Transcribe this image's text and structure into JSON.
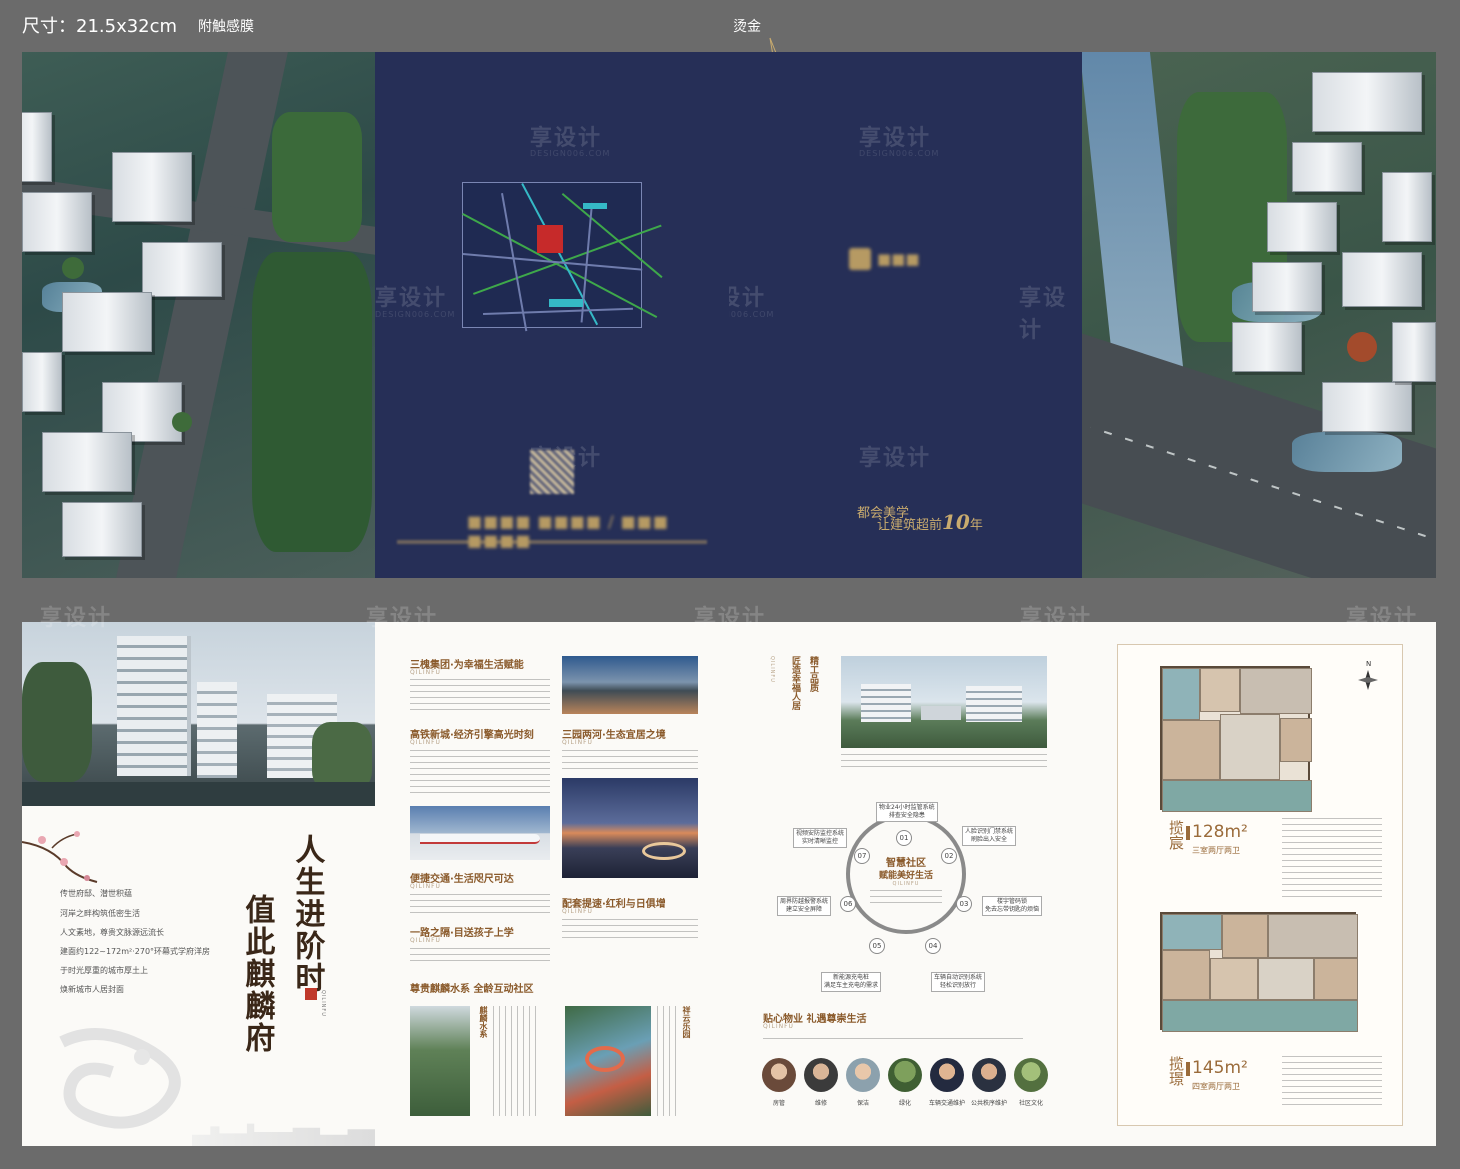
{
  "header": {
    "size_label": "尺寸：21.5x32cm",
    "finish_label": "附触感膜",
    "foil_label": "烫金"
  },
  "watermark": {
    "text": "享设计",
    "sub": "DESIGN006.COM"
  },
  "cover": {
    "slogan_line1": "都会美学",
    "slogan_line2_prefix": "让建筑超前",
    "slogan_number": "10",
    "slogan_suffix": "年"
  },
  "page_intro": {
    "lines": [
      "传世府邸、潜世积蕴",
      "河岸之畔构筑低密生活",
      "人文素地，尊贵文脉源远流长",
      "建面约122~172m²·270°环幕式学府洋房",
      "于时光厚重的城市厚土上",
      "焕新城市人居封面"
    ],
    "calligraphy_1": "人生进阶时",
    "calligraphy_2": "值此麒麟府",
    "seal": "QILINFU"
  },
  "page_features": {
    "sections": [
      {
        "title": "三槐集团·为幸福生活赋能",
        "sub": "QILINFU"
      },
      {
        "title": "高铁新城·经济引擎高光时刻",
        "sub": "QILINFU"
      },
      {
        "title": "三园两河·生态宜居之境",
        "sub": "QILINFU"
      },
      {
        "title": "便捷交通·生活咫尺可达",
        "sub": "QILINFU"
      },
      {
        "title": "配套提速·红利与日俱增",
        "sub": "QILINFU"
      },
      {
        "title": "一路之隔·目送孩子上学",
        "sub": "QILINFU"
      },
      {
        "title": "尊贵麒麟水系 全龄互动社区",
        "sub": ""
      }
    ],
    "vertical_1": "麒麟水系",
    "vertical_2": "祥云乐园"
  },
  "page_community": {
    "heading_vertical_1": "精工品质",
    "heading_vertical_2": "匠造幸福人居",
    "heading_sub": "QILINFU",
    "center_title_1": "智慧社区",
    "center_title_2": "赋能美好生活",
    "center_sub": "QILINFU",
    "nodes": [
      "01",
      "02",
      "03",
      "04",
      "05",
      "06",
      "07"
    ],
    "tags": [
      "物业24小时监管系统\n排查安全隐患",
      "人脸识别门禁系统\n刷脸出入安全",
      "楼宇管码锁\n免去忘带钥匙的烦恼",
      "车辆自动识别系统\n轻松识别放行",
      "新能源充电桩\n满足车主充电的需求",
      "周界防越报警系统\n建立安全屏障",
      "视频安防监控系统\n实时清晰监控"
    ],
    "service_title": "贴心物业 礼遇尊崇生活",
    "service_sub": "QILINFU",
    "services": [
      "房管",
      "维修",
      "保洁",
      "绿化",
      "车辆交通维护",
      "公共秩序维护",
      "社区文化"
    ]
  },
  "page_floorplans": {
    "compass": "N",
    "plan1": {
      "name": "揽宸",
      "area": "128",
      "unit": "m²",
      "layout": "三室两厅两卫"
    },
    "plan2": {
      "name": "揽璟",
      "area": "145",
      "unit": "m²",
      "layout": "四室两厅两卫"
    }
  },
  "colors": {
    "navy": "#262f57",
    "gold": "#b69a63",
    "brown_text": "#8a5a2b",
    "background": "#6b6b6b"
  }
}
